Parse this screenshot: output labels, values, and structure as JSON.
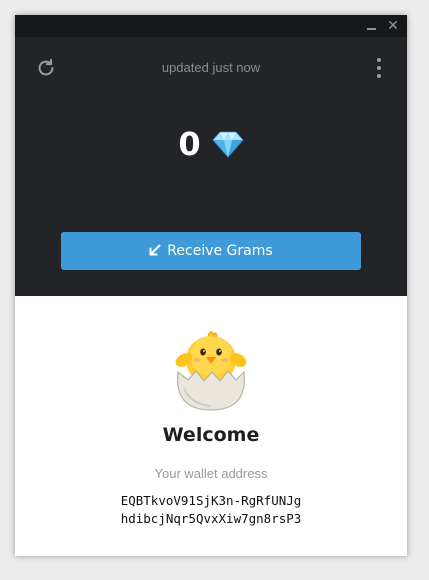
{
  "titlebar": {
    "minimize_icon": "minimize-icon",
    "close_label": "✕"
  },
  "header": {
    "refresh_icon": "refresh-icon",
    "status": "updated just now",
    "menu_icon": "more-vertical-icon"
  },
  "balance": {
    "value": "0",
    "currency_icon": "diamond-icon"
  },
  "actions": {
    "receive_label": "Receive Grams",
    "receive_icon": "arrow-down-left-icon",
    "accent_color": "#3e9bd7"
  },
  "welcome": {
    "illustration": "hatching-chick-icon",
    "title": "Welcome",
    "address_label": "Your wallet address",
    "address_line1": "EQBTkvoV91SjK3n-RgRfUNJg",
    "address_line2": "hdibcjNqr5QvxXiw7gn8rsP3"
  },
  "colors": {
    "dark_bg": "#232427",
    "titlebar_bg": "#17181a",
    "light_bg": "#ffffff"
  }
}
